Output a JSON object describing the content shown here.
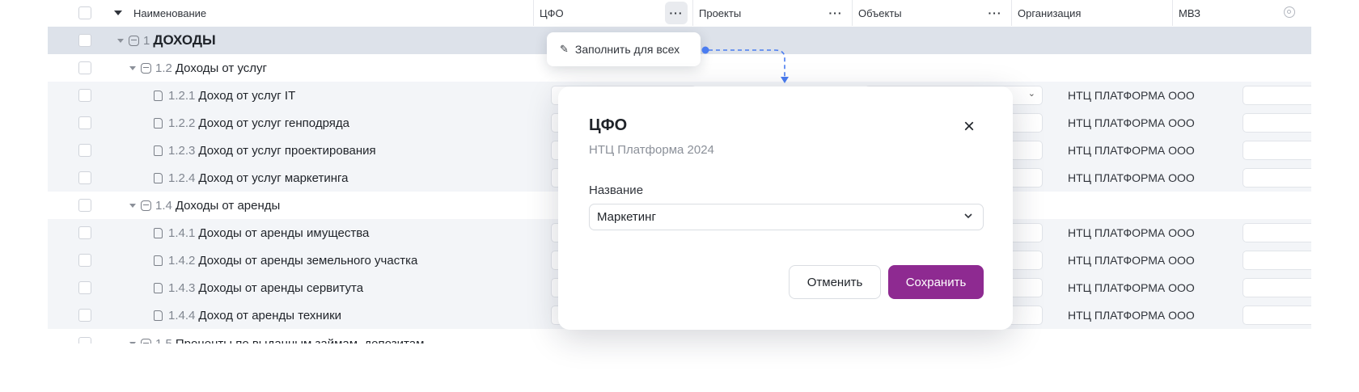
{
  "header": {
    "name_col": "Наименование",
    "cfo_col": "ЦФО",
    "projects_col": "Проекты",
    "objects_col": "Объекты",
    "org_col": "Организация",
    "mvz_col": "МВЗ",
    "more_icon": "···"
  },
  "rows": [
    {
      "num": "1",
      "label": "ДОХОДЫ",
      "type": "group0"
    },
    {
      "num": "1.2",
      "label": "Доходы от услуг",
      "type": "group1"
    },
    {
      "num": "1.2.1",
      "label": "Доход от услуг IT",
      "type": "leaf",
      "org": "НТЦ ПЛАТФОРМА ООО"
    },
    {
      "num": "1.2.2",
      "label": "Доход от услуг генподряда",
      "type": "leaf",
      "org": "НТЦ ПЛАТФОРМА ООО"
    },
    {
      "num": "1.2.3",
      "label": "Доход от услуг проектирования",
      "type": "leaf",
      "org": "НТЦ ПЛАТФОРМА ООО"
    },
    {
      "num": "1.2.4",
      "label": "Доход от услуг маркетинга",
      "type": "leaf",
      "org": "НТЦ ПЛАТФОРМА ООО"
    },
    {
      "num": "1.4",
      "label": "Доходы от аренды",
      "type": "group1"
    },
    {
      "num": "1.4.1",
      "label": "Доходы от аренды имущества",
      "type": "leaf",
      "org": "НТЦ ПЛАТФОРМА ООО"
    },
    {
      "num": "1.4.2",
      "label": "Доходы от аренды земельного участка",
      "type": "leaf",
      "org": "НТЦ ПЛАТФОРМА ООО"
    },
    {
      "num": "1.4.3",
      "label": "Доходы от аренды сервитута",
      "type": "leaf",
      "org": "НТЦ ПЛАТФОРМА ООО"
    },
    {
      "num": "1.4.4",
      "label": "Доход от аренды техники",
      "type": "leaf",
      "org": "НТЦ ПЛАТФОРМА ООО"
    },
    {
      "num": "1.5",
      "label": "Проценты по выданным займам, депозитам",
      "type": "group1"
    }
  ],
  "popover": {
    "label": "Заполнить для всех",
    "icon": "pen-icon"
  },
  "modal": {
    "title": "ЦФО",
    "subtitle": "НТЦ Платформа 2024",
    "field_label": "Название",
    "field_value": "Маркетинг",
    "cancel": "Отменить",
    "save": "Сохранить",
    "close_icon": "×"
  },
  "colors": {
    "accent": "#8e2a91",
    "connector": "#4a7cf0",
    "group_row": "#dde2ea"
  }
}
